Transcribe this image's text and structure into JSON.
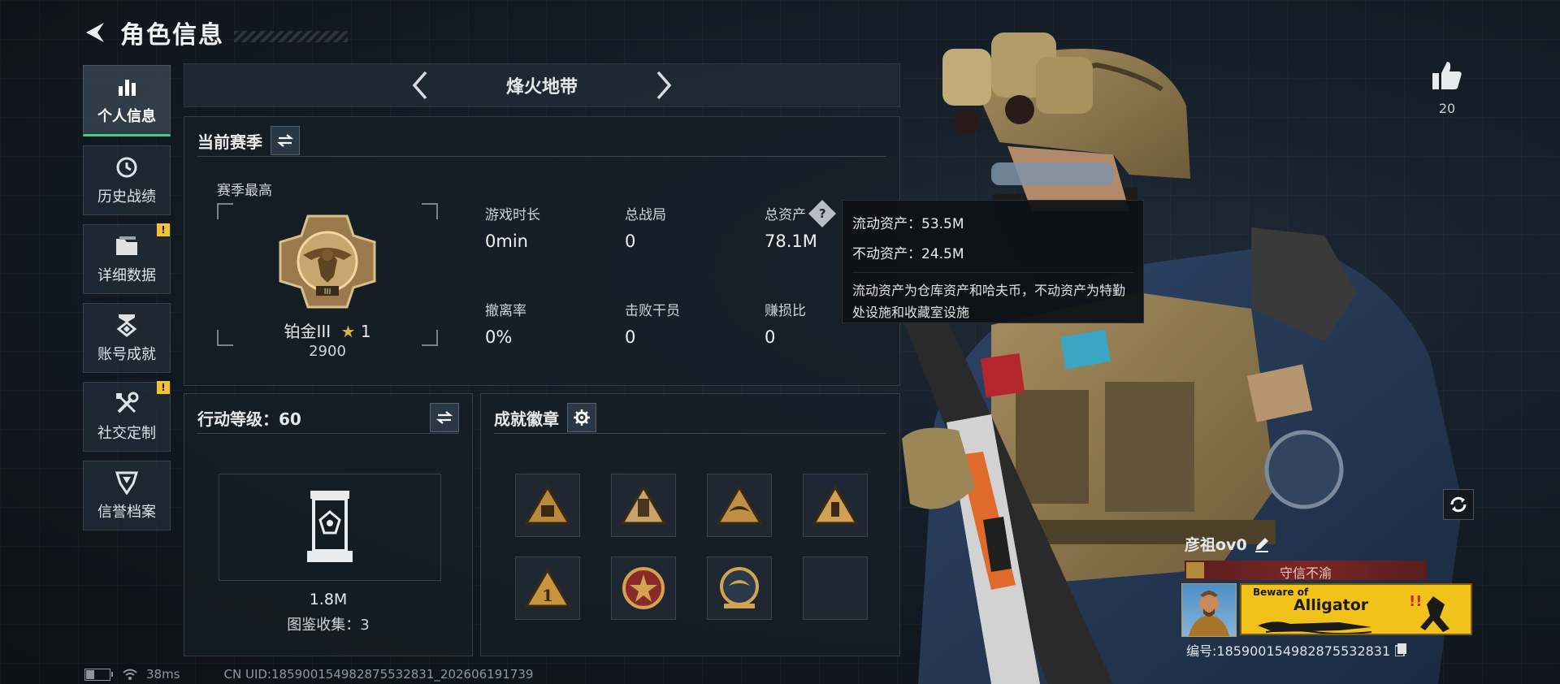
{
  "header": {
    "title": "角色信息"
  },
  "sidebar": {
    "items": [
      {
        "label": "个人信息",
        "icon": "bar-chart-icon",
        "active": true,
        "warning": false
      },
      {
        "label": "历史战绩",
        "icon": "clock-icon",
        "active": false,
        "warning": false
      },
      {
        "label": "详细数据",
        "icon": "folder-icon",
        "active": false,
        "warning": true
      },
      {
        "label": "账号成就",
        "icon": "achievement-icon",
        "active": false,
        "warning": false
      },
      {
        "label": "社交定制",
        "icon": "tools-icon",
        "active": false,
        "warning": true
      },
      {
        "label": "信誉档案",
        "icon": "shield-icon",
        "active": false,
        "warning": false
      }
    ],
    "warning_mark": "!"
  },
  "mode": {
    "title": "烽火地带"
  },
  "season": {
    "title": "当前赛季",
    "best_label": "赛季最高",
    "rank_name": "铂金III",
    "rank_stars": "1",
    "rank_score": "2900",
    "stats": [
      {
        "label": "游戏时长",
        "value": "0min"
      },
      {
        "label": "总战局",
        "value": "0"
      },
      {
        "label": "总资产",
        "value": "78.1M",
        "help": "?"
      },
      {
        "label": "撤离率",
        "value": "0%"
      },
      {
        "label": "击败干员",
        "value": "0"
      },
      {
        "label": "赚损比",
        "value": "0"
      }
    ]
  },
  "tooltip": {
    "liquid": "流动资产：53.5M",
    "fixed": "不动资产：24.5M",
    "desc": "流动资产为仓库资产和哈夫币，不动资产为特勤处设施和收藏室设施"
  },
  "level": {
    "title": "行动等级：60",
    "collection_value": "1.8M",
    "collection_count": "图鉴收集：3"
  },
  "badges": {
    "title": "成就徽章",
    "items": [
      {
        "icon": "badge-triangle-gold-icon"
      },
      {
        "icon": "badge-scroll-icon"
      },
      {
        "icon": "badge-triangle-wings-icon"
      },
      {
        "icon": "badge-triangle-bottle-icon"
      },
      {
        "icon": "badge-number-one-icon"
      },
      {
        "icon": "badge-star-medal-icon"
      },
      {
        "icon": "badge-eagle-shield-icon"
      },
      {
        "icon": "badge-empty-slot"
      }
    ]
  },
  "profile": {
    "likes": "20",
    "name": "彦祖ov0",
    "honor_title": "守信不渝",
    "card_top": "Beware of",
    "card_main": "Alligator",
    "id": "编号:185900154982875532831"
  },
  "footer": {
    "ping": "38ms",
    "uid": "CN UID:185900154982875532831_202606191739",
    "battery_level": 0.35
  },
  "colors": {
    "accent": "#3ed08a",
    "warning": "#f2c230",
    "card": "#f1c21a",
    "honor": "#7a2626"
  }
}
